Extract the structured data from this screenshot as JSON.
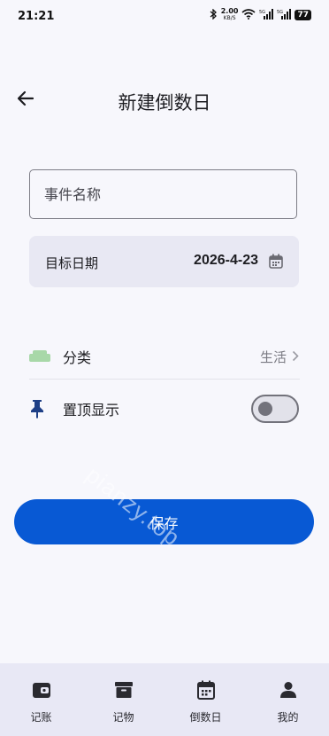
{
  "status_bar": {
    "time": "21:21",
    "speed_value": "2.00",
    "speed_unit": "KB/S",
    "battery": "77"
  },
  "header": {
    "title": "新建倒数日"
  },
  "form": {
    "name_placeholder": "事件名称",
    "name_value": "",
    "date_label": "目标日期",
    "date_value": "2026-4-23",
    "category_label": "分类",
    "category_value": "生活",
    "pin_label": "置顶显示",
    "pin_enabled": false,
    "save_label": "保存"
  },
  "watermark": "pianzy.top",
  "bottom_nav": {
    "items": [
      {
        "label": "记账",
        "icon": "wallet-icon"
      },
      {
        "label": "记物",
        "icon": "archive-box-icon"
      },
      {
        "label": "倒数日",
        "icon": "calendar-icon"
      },
      {
        "label": "我的",
        "icon": "person-icon"
      }
    ]
  },
  "colors": {
    "primary": "#0859d4",
    "background": "#f7f7fc",
    "card": "#e8e8f3",
    "nav": "#e8e8f5",
    "sofa_icon": "#a8d8a8",
    "pin_icon": "#1e3f86"
  }
}
